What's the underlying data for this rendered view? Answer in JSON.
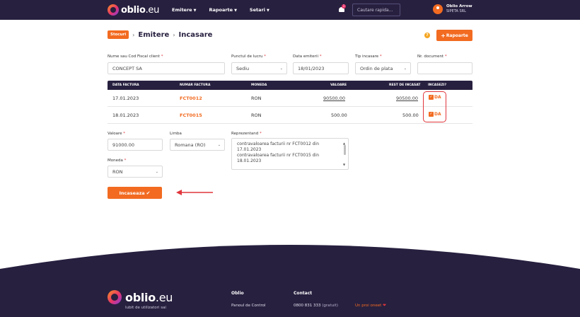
{
  "header": {
    "brand": "oblio",
    "brand_tld": ".eu",
    "nav": [
      "Emitere",
      "Rapoarte",
      "Setari"
    ],
    "notification_count": "1",
    "search_placeholder": "Cautare rapida...",
    "user_name": "Oblio Arrow",
    "user_company": "SIPETA SRL"
  },
  "breadcrumb": {
    "pill": "Stocuri",
    "items": [
      "Emitere",
      "Incasare"
    ],
    "reports_button": "Rapoarte"
  },
  "form": {
    "client_label": "Nume sau Cod Fiscal client",
    "client_value": "CONCEPT SA",
    "workplace_label": "Punctul de lucru",
    "workplace_value": "Sediu",
    "issue_date_label": "Data emiterii",
    "issue_date_value": "18/01/2023",
    "payment_type_label": "Tip incasare",
    "payment_type_value": "Ordin de plata",
    "doc_number_label": "Nr. document",
    "doc_number_value": ""
  },
  "table": {
    "headers": [
      "DATA FACTURA",
      "NUMAR FACTURA",
      "MONEDA",
      "VALOARE",
      "REST DE INCASAT",
      "INCASEZI?"
    ],
    "rows": [
      {
        "date": "17.01.2023",
        "number": "FCT0012",
        "currency": "RON",
        "value": "90500.00",
        "rest": "90500.00",
        "collect": "DA"
      },
      {
        "date": "18.01.2023",
        "number": "FCT0015",
        "currency": "RON",
        "value": "500.00",
        "rest": "500.00",
        "collect": "DA"
      }
    ]
  },
  "payment": {
    "value_label": "Valoare",
    "value": "91000.00",
    "language_label": "Limba",
    "language_value": "Romana (RO)",
    "representing_label": "Reprezentand",
    "representing_lines": [
      "contravaloarea facturii nr FCT0012 din",
      "17.01.2023",
      "contravaloarea facturii nr FCT0015 din",
      "18.01.2023"
    ],
    "currency_label": "Moneda",
    "currency_value": "RON",
    "submit_label": "Incaseaza"
  },
  "footer": {
    "brand": "oblio",
    "brand_tld": ".eu",
    "tagline": "Iubit de utilizatori sai",
    "col1_title": "Oblio",
    "col1_link": "Panoul de Control",
    "col2_title": "Contact",
    "phone": "0800 831 333",
    "phone_note": "(gratuit)",
    "love_text": "Un proi oneet"
  },
  "colors": {
    "accent": "#f26b21",
    "navbar": "#28203f",
    "highlight": "#e0353b"
  }
}
